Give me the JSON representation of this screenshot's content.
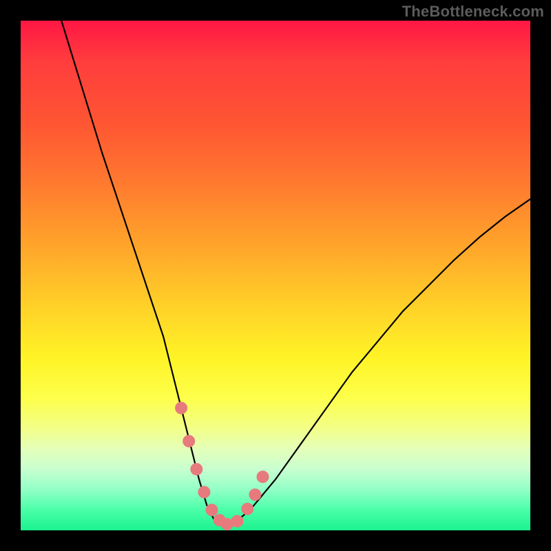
{
  "watermark": "TheBottleneck.com",
  "chart_data": {
    "type": "line",
    "title": "",
    "xlabel": "",
    "ylabel": "",
    "xlim": [
      0,
      100
    ],
    "ylim": [
      0,
      100
    ],
    "grid": false,
    "legend": false,
    "series": [
      {
        "name": "bottleneck-curve",
        "x": [
          8,
          12,
          16,
          20,
          24,
          28,
          31,
          33,
          35,
          36.5,
          38,
          40,
          42,
          45,
          50,
          55,
          60,
          65,
          70,
          75,
          80,
          85,
          90,
          95,
          100
        ],
        "values": [
          100,
          87,
          74,
          62,
          50,
          38,
          26,
          18,
          10,
          5,
          2,
          1,
          1.5,
          4,
          10,
          17,
          24,
          31,
          37,
          43,
          48,
          53,
          57.5,
          61.5,
          65
        ]
      }
    ],
    "marker_points": {
      "name": "highlight-dots",
      "color": "#e77a7d",
      "x": [
        31.5,
        33,
        34.5,
        36,
        37.5,
        39,
        40.5,
        42.5,
        44.5,
        46,
        47.5
      ],
      "values": [
        24,
        17.5,
        12,
        7.5,
        4,
        2,
        1.2,
        1.8,
        4.2,
        7,
        10.5
      ]
    },
    "gradient_stops": [
      {
        "pos": 0,
        "color": "#ff1744"
      },
      {
        "pos": 20,
        "color": "#ff5533"
      },
      {
        "pos": 44,
        "color": "#ffa42a"
      },
      {
        "pos": 66,
        "color": "#fff326"
      },
      {
        "pos": 88,
        "color": "#c8ffd0"
      },
      {
        "pos": 100,
        "color": "#1cf28f"
      }
    ]
  }
}
